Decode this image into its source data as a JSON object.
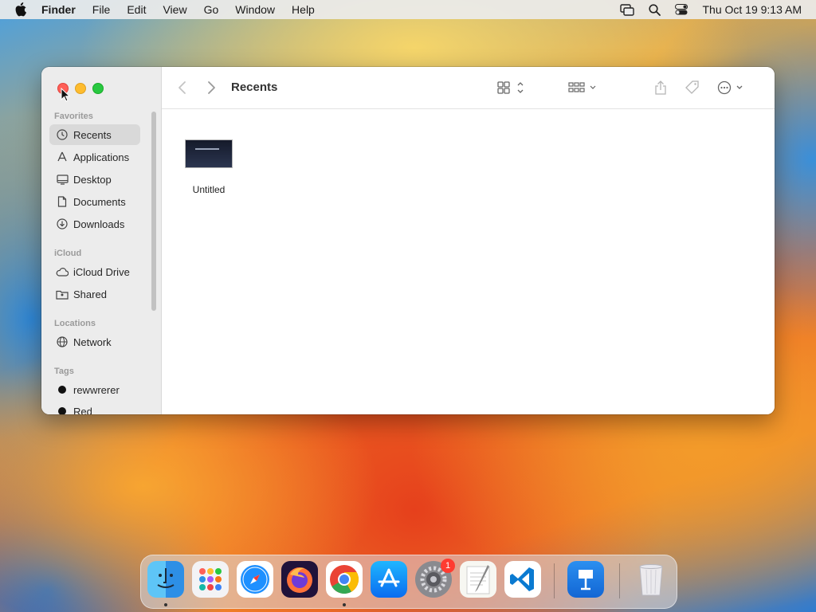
{
  "menubar": {
    "app_name": "Finder",
    "menus": [
      "File",
      "Edit",
      "View",
      "Go",
      "Window",
      "Help"
    ],
    "datetime": "Thu Oct 19  9:13 AM"
  },
  "window": {
    "title": "Recents",
    "sidebar": {
      "favorites_header": "Favorites",
      "favorites": [
        {
          "label": "Recents",
          "icon": "clock-icon",
          "active": true
        },
        {
          "label": "Applications",
          "icon": "applications-icon"
        },
        {
          "label": "Desktop",
          "icon": "desktop-icon"
        },
        {
          "label": "Documents",
          "icon": "document-icon"
        },
        {
          "label": "Downloads",
          "icon": "download-icon"
        }
      ],
      "icloud_header": "iCloud",
      "icloud": [
        {
          "label": "iCloud Drive",
          "icon": "cloud-icon"
        },
        {
          "label": "Shared",
          "icon": "shared-folder-icon"
        }
      ],
      "locations_header": "Locations",
      "locations": [
        {
          "label": "Network",
          "icon": "globe-icon"
        }
      ],
      "tags_header": "Tags",
      "tags": [
        {
          "label": "rewwrerer",
          "color": "#111111"
        },
        {
          "label": "Red",
          "color": "#111111"
        }
      ]
    },
    "files": [
      {
        "name": "Untitled"
      }
    ]
  },
  "dock": {
    "apps": [
      "Finder",
      "Launchpad",
      "Safari",
      "Firefox",
      "Chrome",
      "App Store",
      "System Settings",
      "TextEdit",
      "Visual Studio Code",
      "Keynote",
      "Trash"
    ],
    "settings_badge": "1"
  },
  "colors": {
    "close": "#ff5f57",
    "minimize": "#febc2e",
    "zoom": "#28c840"
  }
}
